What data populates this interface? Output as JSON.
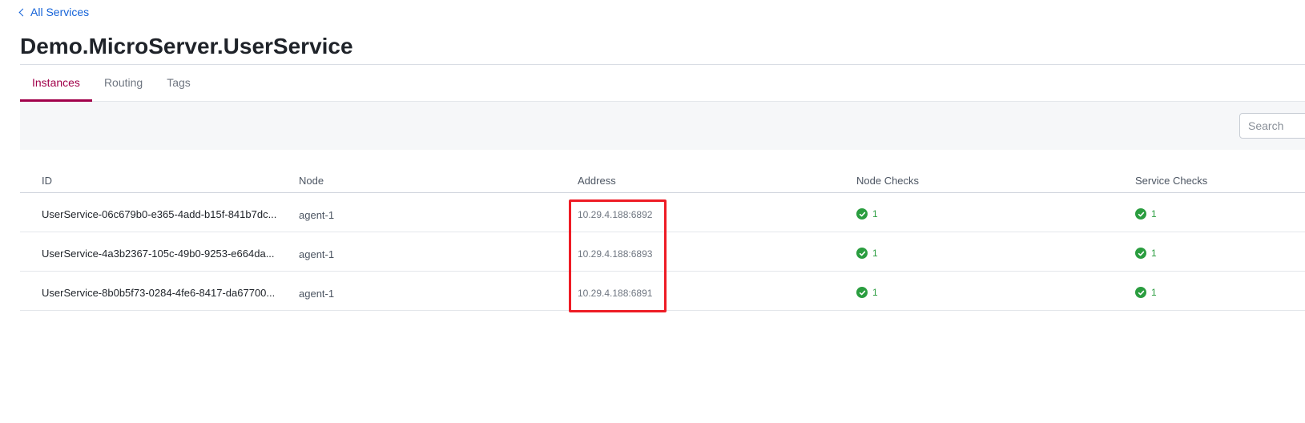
{
  "breadcrumb": {
    "label": "All Services"
  },
  "page": {
    "title": "Demo.MicroServer.UserService"
  },
  "tabs": [
    {
      "label": "Instances",
      "active": true
    },
    {
      "label": "Routing",
      "active": false
    },
    {
      "label": "Tags",
      "active": false
    }
  ],
  "search": {
    "placeholder": "Search"
  },
  "table": {
    "headers": {
      "id": "ID",
      "node": "Node",
      "address": "Address",
      "node_checks": "Node Checks",
      "service_checks": "Service Checks"
    },
    "rows": [
      {
        "id": "UserService-06c679b0-e365-4add-b15f-841b7dc...",
        "node": "agent-1",
        "address": "10.29.4.188:6892",
        "node_checks": "1",
        "service_checks": "1"
      },
      {
        "id": "UserService-4a3b2367-105c-49b0-9253-e664da...",
        "node": "agent-1",
        "address": "10.29.4.188:6893",
        "node_checks": "1",
        "service_checks": "1"
      },
      {
        "id": "UserService-8b0b5f73-0284-4fe6-8417-da67700...",
        "node": "agent-1",
        "address": "10.29.4.188:6891",
        "node_checks": "1",
        "service_checks": "1"
      }
    ]
  },
  "icons": {
    "back": "chevron-left-icon",
    "check": "check-circle-icon"
  },
  "colors": {
    "link": "#1563d8",
    "active_tab": "#a1004a",
    "passing": "#2a9d3f",
    "highlight": "#ee1c25"
  }
}
